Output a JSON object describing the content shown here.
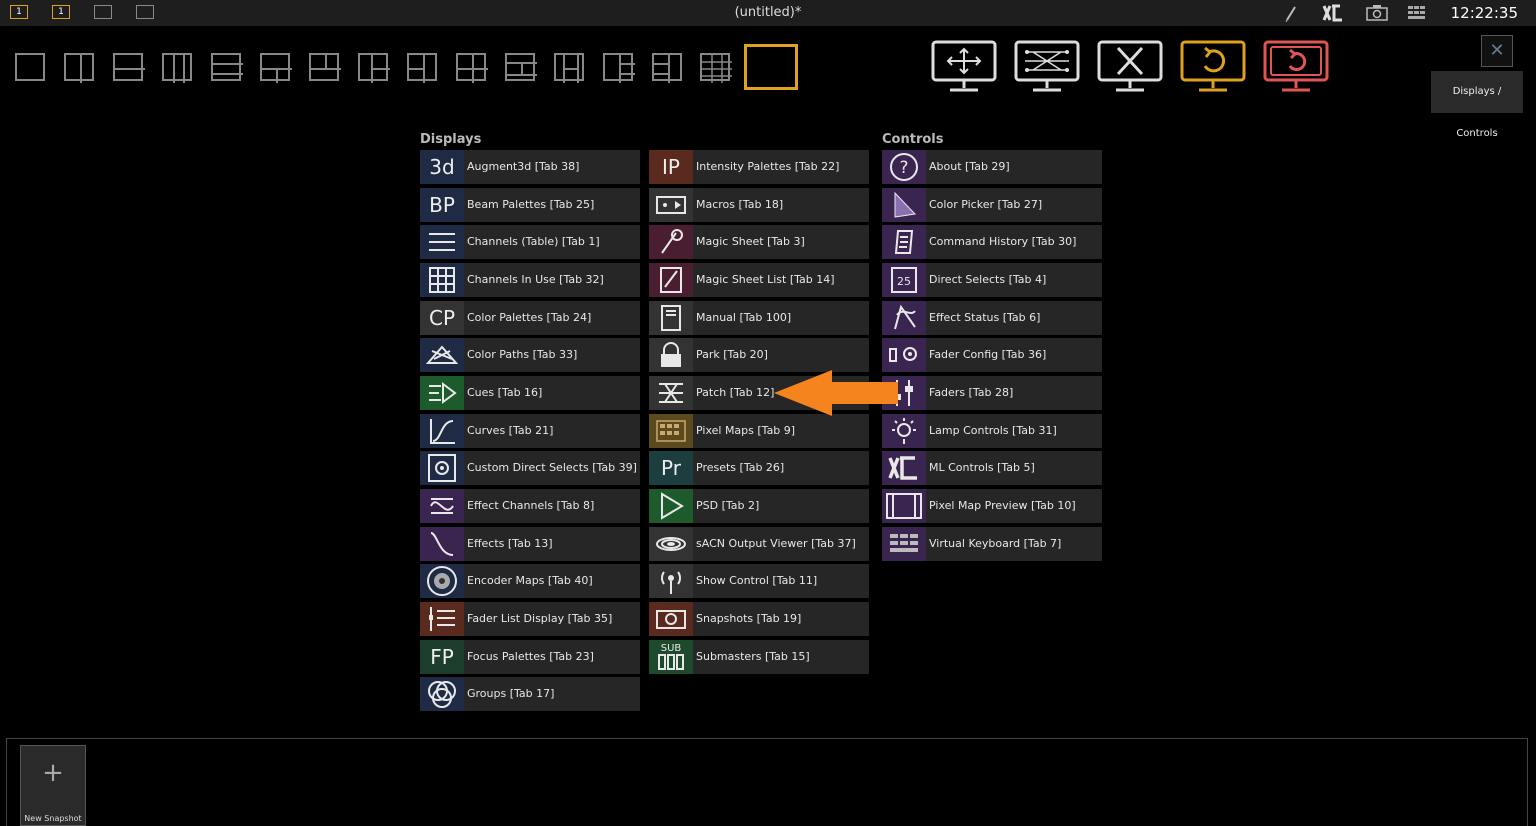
{
  "topbar": {
    "title": "(untitled)*",
    "clock": "12:22:35",
    "workspaces": [
      "1",
      "1",
      "",
      ""
    ]
  },
  "header": {
    "panel_label": "Displays / Controls",
    "close_label": "✕"
  },
  "colors": {
    "accent": "#e0a020",
    "danger": "#e05555",
    "arrow": "#f5841f"
  },
  "displays": {
    "title": "Displays",
    "items": [
      {
        "label": "Augment3d [Tab 38]",
        "icon": "augment3d-icon",
        "glyph": "3d",
        "bg": "#1f2a44"
      },
      {
        "label": "Beam Palettes [Tab 25]",
        "icon": "beam-palettes-icon",
        "glyph": "BP",
        "bg": "#1f2a44"
      },
      {
        "label": "Channels (Table) [Tab 1]",
        "icon": "channels-table-icon",
        "glyph": "",
        "bg": "#1f2a44"
      },
      {
        "label": "Channels In Use [Tab 32]",
        "icon": "channels-in-use-icon",
        "glyph": "",
        "bg": "#1f2a44"
      },
      {
        "label": "Color Palettes [Tab 24]",
        "icon": "color-palettes-icon",
        "glyph": "CP",
        "bg": "#333"
      },
      {
        "label": "Color Paths [Tab 33]",
        "icon": "color-paths-icon",
        "glyph": "",
        "bg": "#1f2a44"
      },
      {
        "label": "Cues [Tab 16]",
        "icon": "cues-icon",
        "glyph": "",
        "bg": "#1d5a2c"
      },
      {
        "label": "Curves [Tab 21]",
        "icon": "curves-icon",
        "glyph": "",
        "bg": "#1f2a44"
      },
      {
        "label": "Custom Direct Selects [Tab 39]",
        "icon": "custom-direct-selects-icon",
        "glyph": "",
        "bg": "#1f2a44"
      },
      {
        "label": "Effect Channels [Tab 8]",
        "icon": "effect-channels-icon",
        "glyph": "",
        "bg": "#3a2450"
      },
      {
        "label": "Effects [Tab 13]",
        "icon": "effects-icon",
        "glyph": "",
        "bg": "#3a2450"
      },
      {
        "label": "Encoder Maps [Tab 40]",
        "icon": "encoder-maps-icon",
        "glyph": "",
        "bg": "#1f2a44"
      },
      {
        "label": "Fader List Display [Tab 35]",
        "icon": "fader-list-display-icon",
        "glyph": "",
        "bg": "#5a2a1e"
      },
      {
        "label": "Focus Palettes [Tab 23]",
        "icon": "focus-palettes-icon",
        "glyph": "FP",
        "bg": "#1d3e2c"
      },
      {
        "label": "Groups [Tab 17]",
        "icon": "groups-icon",
        "glyph": "",
        "bg": "#1f2a44"
      }
    ]
  },
  "middle": {
    "items": [
      {
        "label": "Intensity Palettes [Tab 22]",
        "icon": "intensity-palettes-icon",
        "glyph": "IP",
        "bg": "#5a2a1e"
      },
      {
        "label": "Macros [Tab 18]",
        "icon": "macros-icon",
        "glyph": "",
        "bg": "#333"
      },
      {
        "label": "Magic Sheet [Tab 3]",
        "icon": "magic-sheet-icon",
        "glyph": "",
        "bg": "#4a1e30"
      },
      {
        "label": "Magic Sheet List [Tab 14]",
        "icon": "magic-sheet-list-icon",
        "glyph": "",
        "bg": "#4a1e30"
      },
      {
        "label": "Manual [Tab 100]",
        "icon": "manual-icon",
        "glyph": "",
        "bg": "#333"
      },
      {
        "label": "Park [Tab 20]",
        "icon": "park-icon",
        "glyph": "",
        "bg": "#333"
      },
      {
        "label": "Patch [Tab 12]",
        "icon": "patch-icon",
        "glyph": "",
        "bg": "#333"
      },
      {
        "label": "Pixel Maps [Tab 9]",
        "icon": "pixel-maps-icon",
        "glyph": "",
        "bg": "#5a4a1e"
      },
      {
        "label": "Presets [Tab 26]",
        "icon": "presets-icon",
        "glyph": "Pr",
        "bg": "#1d3e3e"
      },
      {
        "label": "PSD [Tab 2]",
        "icon": "psd-icon",
        "glyph": "",
        "bg": "#1d5a2c"
      },
      {
        "label": "sACN Output Viewer [Tab 37]",
        "icon": "sacn-output-viewer-icon",
        "glyph": "",
        "bg": "#333"
      },
      {
        "label": "Show Control [Tab 11]",
        "icon": "show-control-icon",
        "glyph": "",
        "bg": "#333"
      },
      {
        "label": "Snapshots [Tab 19]",
        "icon": "snapshots-icon",
        "glyph": "",
        "bg": "#5a2a1e"
      },
      {
        "label": "Submasters [Tab 15]",
        "icon": "submasters-icon",
        "glyph": "SUB",
        "bg": "#1d4a2c"
      }
    ]
  },
  "controls": {
    "title": "Controls",
    "items": [
      {
        "label": "About [Tab 29]",
        "icon": "about-icon",
        "glyph": "?",
        "bg": "#3a2450"
      },
      {
        "label": "Color Picker [Tab 27]",
        "icon": "color-picker-icon",
        "glyph": "",
        "bg": "#3a2450"
      },
      {
        "label": "Command History [Tab 30]",
        "icon": "command-history-icon",
        "glyph": "",
        "bg": "#3a2450"
      },
      {
        "label": "Direct Selects [Tab 4]",
        "icon": "direct-selects-icon",
        "glyph": "25",
        "bg": "#3a2450"
      },
      {
        "label": "Effect Status [Tab 6]",
        "icon": "effect-status-icon",
        "glyph": "",
        "bg": "#3a2450"
      },
      {
        "label": "Fader Config [Tab 36]",
        "icon": "fader-config-icon",
        "glyph": "",
        "bg": "#3a2450"
      },
      {
        "label": "Faders [Tab 28]",
        "icon": "faders-icon",
        "glyph": "",
        "bg": "#3a2450"
      },
      {
        "label": "Lamp Controls [Tab 31]",
        "icon": "lamp-controls-icon",
        "glyph": "",
        "bg": "#3a2450"
      },
      {
        "label": "ML Controls [Tab 5]",
        "icon": "ml-controls-icon",
        "glyph": "",
        "bg": "#3a2450"
      },
      {
        "label": "Pixel Map Preview [Tab 10]",
        "icon": "pixel-map-preview-icon",
        "glyph": "",
        "bg": "#3a2450"
      },
      {
        "label": "Virtual Keyboard [Tab 7]",
        "icon": "virtual-keyboard-icon",
        "glyph": "",
        "bg": "#3a2450"
      }
    ]
  },
  "snapshots": {
    "new_label": "New Snapshot",
    "plus": "+"
  }
}
